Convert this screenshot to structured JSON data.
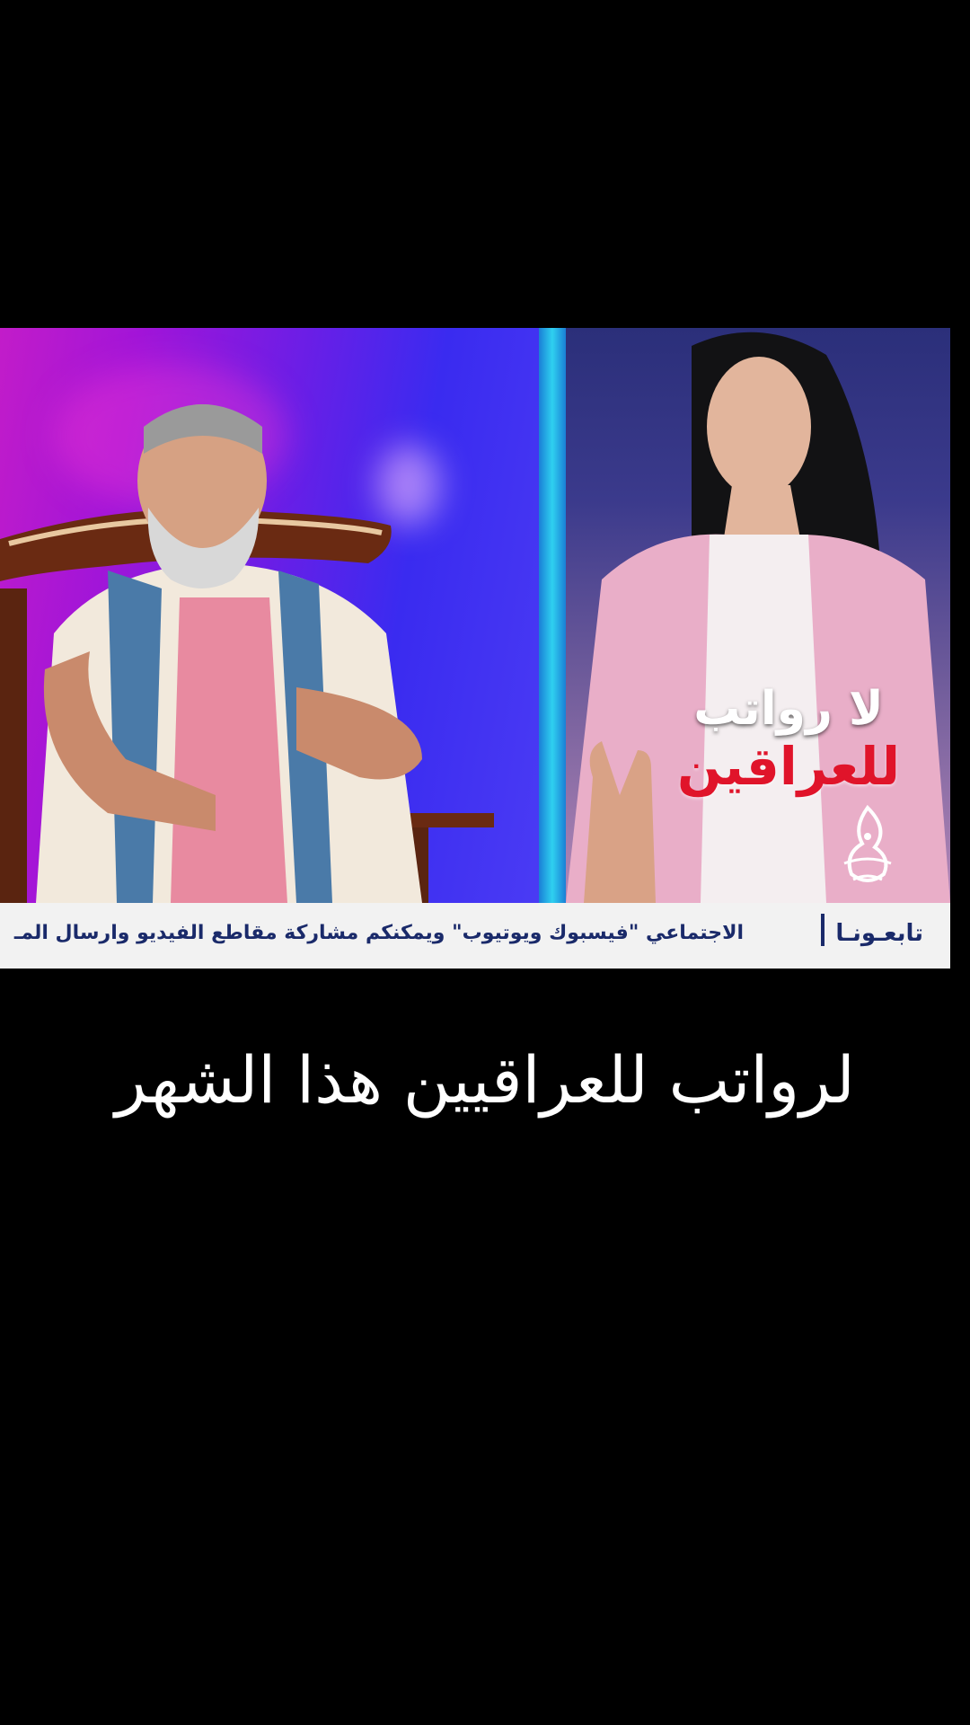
{
  "overlay": {
    "line1": "لا رواتب",
    "line2": "للعراقين"
  },
  "ticker": {
    "label": "تابعـونـا",
    "text": "الاجتماعي \"فيسبوك ويوتيوب\" ويمكنكم مشاركة مقاطع الفيديو وارسال المـ"
  },
  "caption": {
    "text": "لرواتب للعراقيين هذا الشهر"
  },
  "colors": {
    "background": "#000000",
    "overlay_red": "#e0142a",
    "ticker_bg": "#f2f2f2",
    "ticker_text": "#1a2a6a",
    "divider_cyan": "#2fd0f0"
  },
  "icons": {
    "channel_logo": "calligraphy-logo-icon"
  }
}
